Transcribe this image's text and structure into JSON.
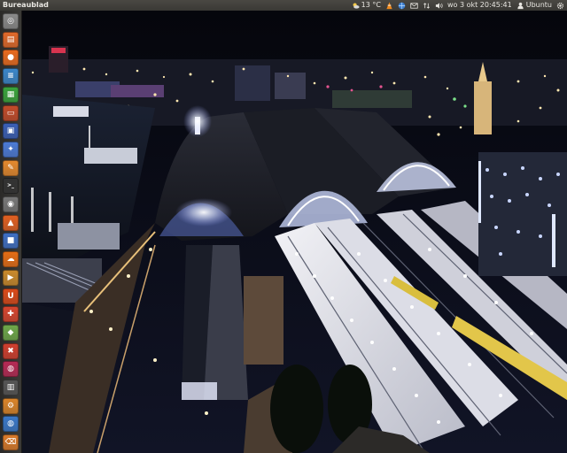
{
  "panel": {
    "app_title": "Bureaublad",
    "weather": "13 °C",
    "datetime": "wo  3 okt 20:45:41",
    "user": "Ubuntu",
    "icons": [
      "weather-icon",
      "vlc-cone-icon",
      "network-globe-icon",
      "mail-envelope-icon",
      "transfer-arrows-icon",
      "volume-speaker-icon",
      "user-icon",
      "settings-gear-icon"
    ]
  },
  "launcher": {
    "items": [
      {
        "icon": "dash-home-icon",
        "color": "#8a8a8a"
      },
      {
        "icon": "files-folder-icon",
        "color": "#e0692a"
      },
      {
        "icon": "firefox-icon",
        "color": "#e86b1f"
      },
      {
        "icon": "writer-document-icon",
        "color": "#3b86c9"
      },
      {
        "icon": "calc-spreadsheet-icon",
        "color": "#3aa33c"
      },
      {
        "icon": "impress-presentation-icon",
        "color": "#c24b2a"
      },
      {
        "icon": "monitor-app-icon",
        "color": "#3a5fb6"
      },
      {
        "icon": "pidgin-chat-icon",
        "color": "#4c7bd6"
      },
      {
        "icon": "text-editor-icon",
        "color": "#e4892e"
      },
      {
        "icon": "terminal-icon",
        "color": "#333333"
      },
      {
        "icon": "camera-icon",
        "color": "#777777"
      },
      {
        "icon": "software-center-icon",
        "color": "#e06022"
      },
      {
        "icon": "package-box-icon",
        "color": "#3f6fc2"
      },
      {
        "icon": "ubuntu-one-icon",
        "color": "#e46d16"
      },
      {
        "icon": "media-app-icon",
        "color": "#c98a2c"
      },
      {
        "icon": "ubuntu-logo-icon",
        "color": "#d94a1a"
      },
      {
        "icon": "tool-app-icon",
        "color": "#d6452f"
      },
      {
        "icon": "green-app-icon",
        "color": "#6ea74a"
      },
      {
        "icon": "wrench-app-icon",
        "color": "#cf3f2f"
      },
      {
        "icon": "pink-app-icon",
        "color": "#b52a55"
      },
      {
        "icon": "system-monitor-icon",
        "color": "#555555"
      },
      {
        "icon": "settings-app-icon",
        "color": "#d9842a"
      },
      {
        "icon": "network-app-icon",
        "color": "#3a78c8"
      },
      {
        "icon": "trash-icon",
        "color": "#d97a2a"
      }
    ]
  },
  "desktop": {
    "wallpaper": "amsterdam-centraal-night-photo"
  }
}
